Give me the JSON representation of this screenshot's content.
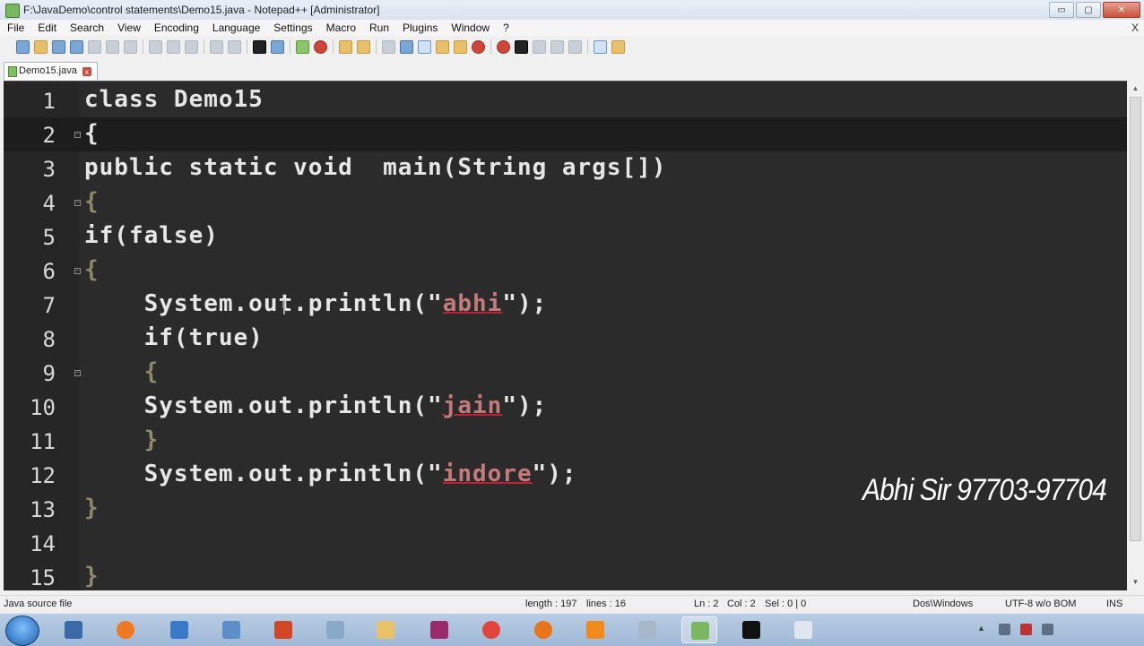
{
  "window": {
    "title": "F:\\JavaDemo\\control statements\\Demo15.java - Notepad++ [Administrator]",
    "min_label": "▭",
    "max_label": "▢",
    "close_label": "✕"
  },
  "menu": {
    "items": [
      "File",
      "Edit",
      "Search",
      "View",
      "Encoding",
      "Language",
      "Settings",
      "Macro",
      "Run",
      "Plugins",
      "Window",
      "?"
    ],
    "close_label": "X"
  },
  "tab": {
    "label": "Demo15.java",
    "close_label": "x"
  },
  "editor": {
    "lines": [
      {
        "n": "1",
        "text": "class Demo15"
      },
      {
        "n": "2",
        "text": "{"
      },
      {
        "n": "3",
        "text": "public static void  main(String args[])"
      },
      {
        "n": "4",
        "text": "{"
      },
      {
        "n": "5",
        "text": "if(false)"
      },
      {
        "n": "6",
        "text": "{"
      },
      {
        "n": "7",
        "text": "    System.out.println(\"abhi\");"
      },
      {
        "n": "8",
        "text": "    if(true)"
      },
      {
        "n": "9",
        "text": "    {"
      },
      {
        "n": "10",
        "text": "    System.out.println(\"jain\");"
      },
      {
        "n": "11",
        "text": "    }"
      },
      {
        "n": "12",
        "text": "    System.out.println(\"indore\");"
      },
      {
        "n": "13",
        "text": "}"
      },
      {
        "n": "14",
        "text": ""
      },
      {
        "n": "15",
        "text": "}"
      }
    ],
    "current_line": 2,
    "watermark": "Abhi Sir 97703-97704",
    "colors": {
      "background": "#2b2b2b",
      "current_line": "#1d1d1d",
      "string": "#c47a7a"
    }
  },
  "status": {
    "file_type": "Java source file",
    "length": "length : 197",
    "lines": "lines : 16",
    "ln": "Ln : 2",
    "col": "Col : 2",
    "sel": "Sel : 0 | 0",
    "eol": "Dos\\Windows",
    "encoding": "UTF-8 w/o BOM",
    "mode": "INS"
  },
  "taskbar": {
    "apps": [
      "start-orb",
      "calendar-app",
      "media-player",
      "remote-desktop",
      "app-window",
      "powerpoint",
      "folders",
      "file-explorer",
      "winrar",
      "chrome",
      "firefox",
      "vlc",
      "tools",
      "notepad-plus-plus",
      "command-prompt",
      "window-app"
    ]
  }
}
